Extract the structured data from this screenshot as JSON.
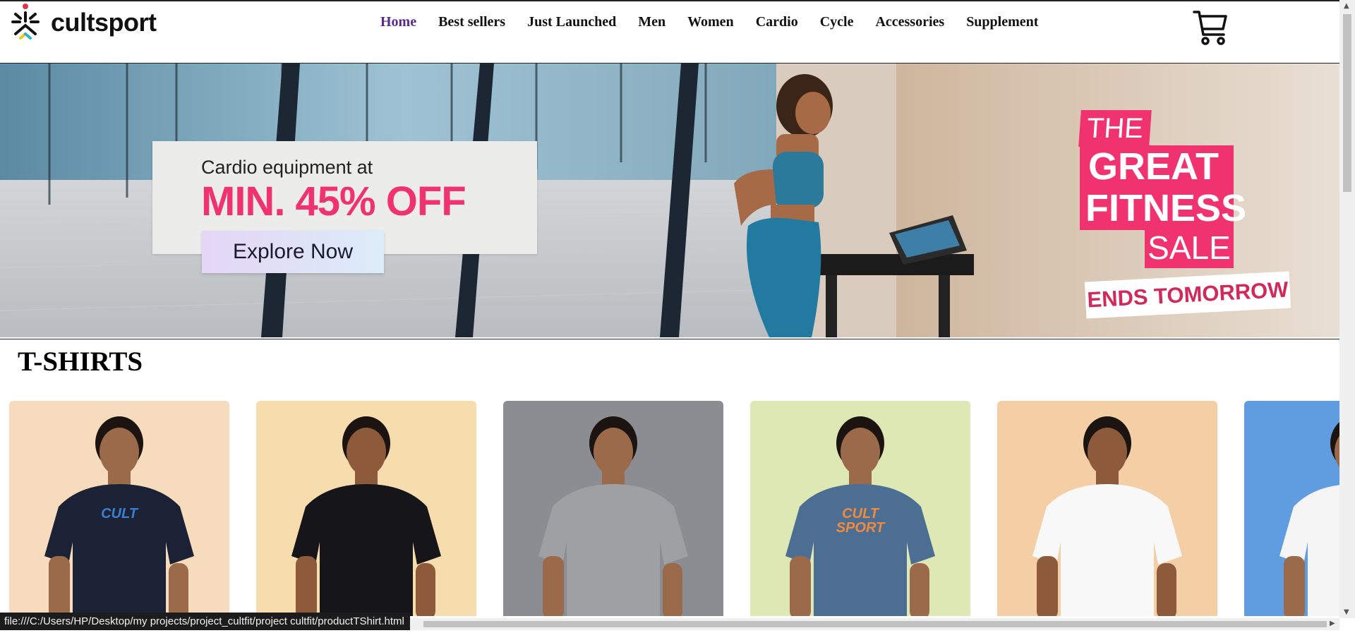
{
  "brand": {
    "name": "cultsport"
  },
  "nav": {
    "items": [
      "Home",
      "Best sellers",
      "Just Launched",
      "Men",
      "Women",
      "Cardio",
      "Cycle",
      "Accessories",
      "Supplement"
    ],
    "active_index": 0
  },
  "header": {
    "cart_icon": "cart-icon"
  },
  "hero": {
    "promo_line1": "Cardio equipment at",
    "promo_line2": "MIN. 45% OFF",
    "cta_label": "Explore Now",
    "sale_the": "THE",
    "sale_great": "GREAT",
    "sale_fitness": "FITNESS",
    "sale_sale": "SALE",
    "sale_ends": "ENDS TOMORROW"
  },
  "section": {
    "title": "T-SHIRTS"
  },
  "products": [
    {
      "bg": "#f6dcbd",
      "shirt": "#1c2235",
      "graphic": "CULT",
      "figure": "man"
    },
    {
      "bg": "#f7dcae",
      "shirt": "#16161a",
      "graphic": "",
      "figure": "woman"
    },
    {
      "bg": "#8c8d92",
      "shirt": "#9ea0a4",
      "graphic": "",
      "figure": "man"
    },
    {
      "bg": "#dde8b4",
      "shirt": "#4d6e93",
      "graphic": "CULT SPORT",
      "figure": "man"
    },
    {
      "bg": "#f4cfa5",
      "shirt": "#f8f8f8",
      "graphic": "",
      "figure": "woman"
    },
    {
      "bg": "#5f9ce0",
      "shirt": "#f5f5f5",
      "graphic": "",
      "figure": "man"
    }
  ],
  "status_bar": {
    "url": "file:///C:/Users/HP/Desktop/my projects/project_cultfit/project cultfit/productTShirt.html"
  },
  "colors": {
    "accent_pink": "#f0336f",
    "nav_active": "#5b2a8c"
  }
}
